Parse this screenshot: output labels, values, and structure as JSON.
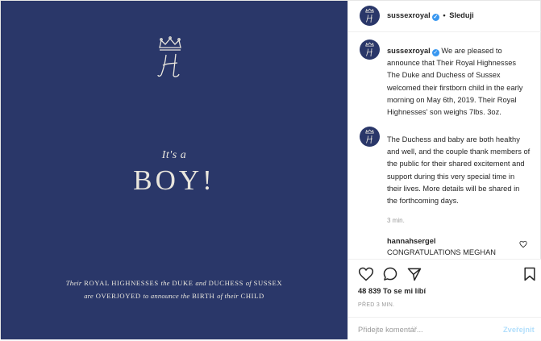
{
  "colors": {
    "media_bg": "#2a3769",
    "media_text": "#e9e6dd",
    "verified_badge": "#3897f0",
    "secondary_text": "#999999",
    "publish_disabled": "#b2dffc"
  },
  "media": {
    "monogram_icon": "crown-h-monogram-icon",
    "its_a": "It's a",
    "boy": "BOY!",
    "line1": {
      "w1": "Their",
      "w2": "ROYAL HIGHNESSES",
      "w3": "the",
      "w4": "DUKE",
      "w5": "and",
      "w6": "DUCHESS",
      "w7": "of",
      "w8": "SUSSEX"
    },
    "line2": {
      "w1": "are",
      "w2": "OVERJOYED",
      "w3": "to announce the",
      "w4": "BIRTH",
      "w5": "of their",
      "w6": "CHILD"
    }
  },
  "header": {
    "username": "sussexroyal",
    "verified_icon": "verified-badge-icon",
    "separator": "•",
    "follow_label": "Sleduji"
  },
  "caption": {
    "username": "sussexroyal",
    "text": "We are pleased to announce that Their Royal Highnesses The Duke and Duchess of Sussex welcomed their firstborn child in the early morning on May 6th, 2019. Their Royal Highnesses' son weighs 7lbs. 3oz."
  },
  "second_comment": {
    "text": "The Duchess and baby are both healthy and well, and the couple thank members of the public for their shared excitement and support during this very special time in their lives. More details will be shared in the forthcoming days."
  },
  "comment_time": "3 min.",
  "third_comment": {
    "username": "hannahsergel",
    "text": "CONGRATULATIONS MEGHAN"
  },
  "actions": {
    "icons": [
      "heart-icon",
      "comment-icon",
      "share-icon",
      "bookmark-icon"
    ],
    "likes_count": "48 839",
    "likes_label": "To se mi líbí",
    "posted": "PŘED 3 MIN."
  },
  "add_comment": {
    "placeholder": "Přidejte komentář...",
    "publish_label": "Zveřejnit"
  }
}
